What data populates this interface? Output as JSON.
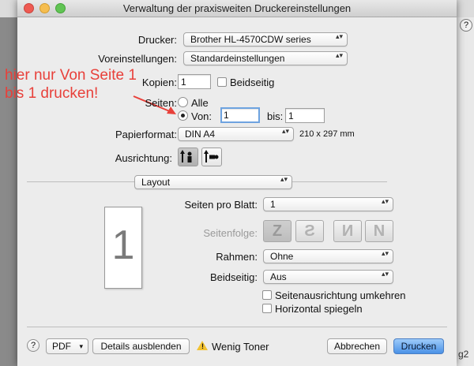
{
  "window": {
    "title": "Verwaltung der praxisweiten Druckereinstellungen"
  },
  "background": {
    "help_label": "?",
    "corner_text": "g2"
  },
  "annotation": {
    "line1": "hier nur Von Seite 1",
    "line2": "bis 1 drucken!"
  },
  "printer": {
    "label": "Drucker:",
    "value": "Brother HL-4570CDW series"
  },
  "presets": {
    "label": "Voreinstellungen:",
    "value": "Standardeinstellungen"
  },
  "copies": {
    "label": "Kopien:",
    "value": "1",
    "duplex_label": "Beidseitig"
  },
  "pages": {
    "label": "Seiten:",
    "all_label": "Alle",
    "from_label": "Von:",
    "from_value": "1",
    "to_label": "bis:",
    "to_value": "1"
  },
  "paper": {
    "label": "Papierformat:",
    "value": "DIN A4",
    "dimensions": "210 x 297 mm"
  },
  "orientation": {
    "label": "Ausrichtung:"
  },
  "section": {
    "value": "Layout"
  },
  "layout": {
    "pages_per_sheet_label": "Seiten pro Blatt:",
    "pages_per_sheet_value": "1",
    "page_order_label": "Seitenfolge:",
    "border_label": "Rahmen:",
    "border_value": "Ohne",
    "duplex_label": "Beidseitig:",
    "duplex_value": "Aus",
    "reverse_label": "Seitenausrichtung umkehren",
    "flip_label": "Horizontal spiegeln"
  },
  "preview": {
    "page_number": "1"
  },
  "footer": {
    "help_label": "?",
    "pdf_label": "PDF",
    "details_label": "Details ausblenden",
    "warning_text": "Wenig Toner",
    "cancel_label": "Abbrechen",
    "print_label": "Drucken"
  },
  "icons": {
    "popup_arrows": "▴▾",
    "chevron": "▾",
    "portrait": "portrait-orientation-icon",
    "landscape": "landscape-orientation-icon",
    "warning": "warning-icon"
  },
  "colors": {
    "annotation": "#e8403a",
    "primary_button": "#4a91e6",
    "focus_ring": "#6ea3e0",
    "warning": "#f2c230"
  }
}
